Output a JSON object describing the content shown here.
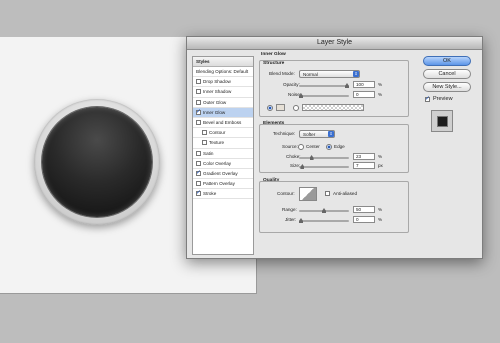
{
  "window": {
    "title": "Layer Style"
  },
  "styles": {
    "header": "Styles",
    "blending": "Blending Options: Default",
    "items": [
      {
        "label": "Drop Shadow",
        "checked": false,
        "selected": false,
        "indent": false
      },
      {
        "label": "Inner Shadow",
        "checked": false,
        "selected": false,
        "indent": false
      },
      {
        "label": "Outer Glow",
        "checked": false,
        "selected": false,
        "indent": false
      },
      {
        "label": "Inner Glow",
        "checked": true,
        "selected": true,
        "indent": false
      },
      {
        "label": "Bevel and Emboss",
        "checked": false,
        "selected": false,
        "indent": false
      },
      {
        "label": "Contour",
        "checked": false,
        "selected": false,
        "indent": true
      },
      {
        "label": "Texture",
        "checked": false,
        "selected": false,
        "indent": true
      },
      {
        "label": "Satin",
        "checked": false,
        "selected": false,
        "indent": false
      },
      {
        "label": "Color Overlay",
        "checked": false,
        "selected": false,
        "indent": false
      },
      {
        "label": "Gradient Overlay",
        "checked": true,
        "selected": false,
        "indent": false
      },
      {
        "label": "Pattern Overlay",
        "checked": false,
        "selected": false,
        "indent": false
      },
      {
        "label": "Stroke",
        "checked": true,
        "selected": false,
        "indent": false
      }
    ]
  },
  "inner_glow": {
    "section_title": "Inner Glow",
    "structure": {
      "title": "Structure",
      "blend_mode_label": "Blend Mode:",
      "blend_mode_value": "Normal",
      "opacity_label": "Opacity:",
      "opacity_value": "100",
      "opacity_fraction": 1.0,
      "noise_label": "Noise:",
      "noise_value": "0",
      "noise_fraction": 0.0,
      "unit": "%"
    },
    "elements": {
      "title": "Elements",
      "technique_label": "Technique:",
      "technique_value": "Softer",
      "source_label": "Source:",
      "center_label": "Center",
      "edge_label": "Edge",
      "source_selected": "edge",
      "choke_label": "Choke:",
      "choke_value": "23",
      "choke_fraction": 0.23,
      "size_label": "Size:",
      "size_value": "7",
      "size_fraction": 0.03,
      "unit_percent": "%",
      "unit_px": "px"
    },
    "quality": {
      "title": "Quality",
      "contour_label": "Contour:",
      "anti_aliased_label": "Anti-aliased",
      "anti_aliased": false,
      "range_label": "Range:",
      "range_value": "50",
      "range_fraction": 0.5,
      "jitter_label": "Jitter:",
      "jitter_value": "0",
      "jitter_fraction": 0.0,
      "unit": "%"
    }
  },
  "buttons": {
    "ok": "OK",
    "cancel": "Cancel",
    "new_style": "New Style...",
    "preview_label": "Preview",
    "preview_checked": true
  }
}
